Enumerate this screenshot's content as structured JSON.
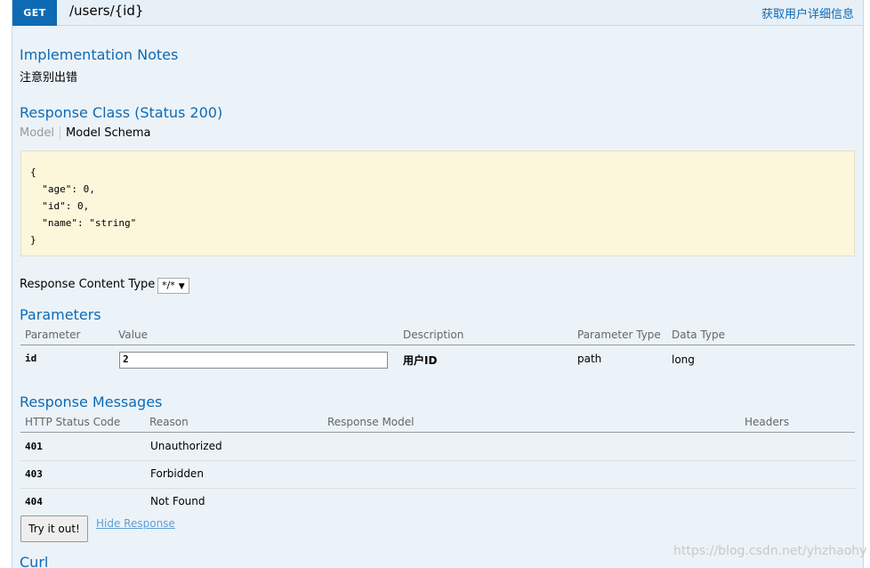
{
  "operation": {
    "method": "GET",
    "path": "/users/{id}",
    "summary": "获取用户详细信息"
  },
  "implementation_notes": {
    "title": "Implementation Notes",
    "text": "注意别出错"
  },
  "response_class": {
    "title": "Response Class (Status 200)",
    "tab_model": "Model",
    "tab_schema": "Model Schema",
    "schema_lines": [
      "{",
      "  \"age\": 0,",
      "  \"id\": 0,",
      "  \"name\": \"string\"",
      "}"
    ]
  },
  "content_type": {
    "label": "Response Content Type",
    "selected": "*/*"
  },
  "parameters": {
    "title": "Parameters",
    "headers": [
      "Parameter",
      "Value",
      "Description",
      "Parameter Type",
      "Data Type"
    ],
    "rows": [
      {
        "name": "id",
        "value": "2",
        "description": "用户ID",
        "param_type": "path",
        "data_type": "long"
      }
    ]
  },
  "response_messages": {
    "title": "Response Messages",
    "headers": [
      "HTTP Status Code",
      "Reason",
      "Response Model",
      "Headers"
    ],
    "rows": [
      {
        "code": "401",
        "reason": "Unauthorized"
      },
      {
        "code": "403",
        "reason": "Forbidden"
      },
      {
        "code": "404",
        "reason": "Not Found"
      }
    ]
  },
  "actions": {
    "try_label": "Try it out!",
    "hide_label": "Hide Response"
  },
  "curl": {
    "title": "Curl"
  },
  "watermark": "https://blog.csdn.net/yhzhaohy",
  "colors": {
    "accent": "#0f6ab4",
    "body_bg": "#ebf3f9",
    "schema_bg": "#fcf6db"
  }
}
